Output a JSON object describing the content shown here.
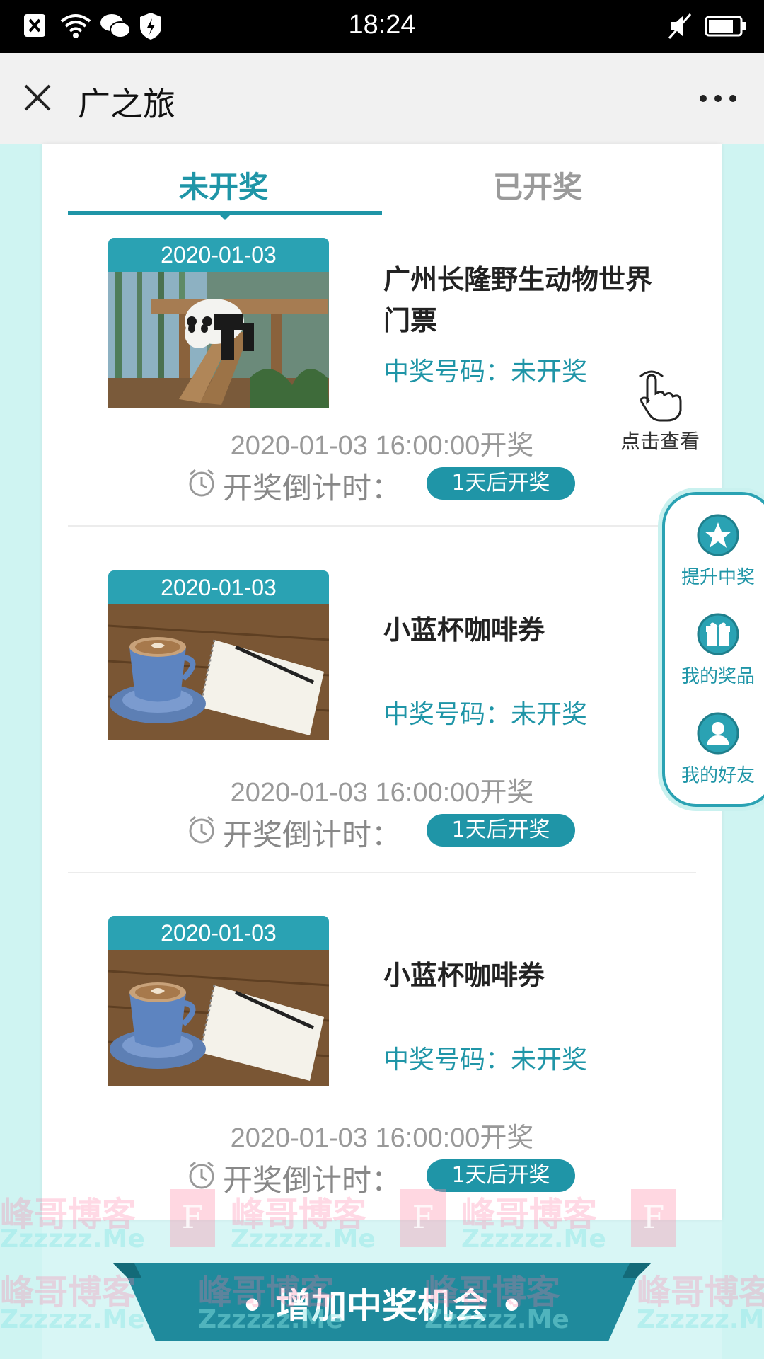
{
  "status_bar": {
    "time": "18:24"
  },
  "nav": {
    "title": "广之旅"
  },
  "tabs": {
    "active": "未开奖",
    "inactive": "已开奖"
  },
  "prizes": [
    {
      "date_tag": "2020-01-03",
      "name": "广州长隆野生动物世界门票",
      "code_label": "中奖号码：未开奖",
      "draw_time": "2020-01-03 16:00:00开奖",
      "countdown_label": "开奖倒计时：",
      "countdown_value": "1天后开奖"
    },
    {
      "date_tag": "2020-01-03",
      "name": "小蓝杯咖啡券",
      "code_label": "中奖号码：未开奖",
      "draw_time": "2020-01-03 16:00:00开奖",
      "countdown_label": "开奖倒计时：",
      "countdown_value": "1天后开奖"
    },
    {
      "date_tag": "2020-01-03",
      "name": "小蓝杯咖啡券",
      "code_label": "中奖号码：未开奖",
      "draw_time": "2020-01-03 16:00:00开奖",
      "countdown_label": "开奖倒计时：",
      "countdown_value": "1天后开奖"
    }
  ],
  "tap_hint": {
    "label": "点击查看",
    "icon": "hand-pointer-icon"
  },
  "side_panel": {
    "items": [
      {
        "label": "提升中奖",
        "icon": "star-icon"
      },
      {
        "label": "我的奖品",
        "icon": "gift-icon"
      },
      {
        "label": "我的好友",
        "icon": "user-icon"
      }
    ]
  },
  "bottom_button": {
    "label": "• 增加中奖机会 •"
  },
  "watermark": {
    "text": "峰哥博客",
    "sub": "Zzzzzz.Me",
    "logo": "F"
  },
  "colors": {
    "accent": "#1f95a7",
    "tag": "#2aa2b3",
    "background": "#d8f6f5"
  }
}
